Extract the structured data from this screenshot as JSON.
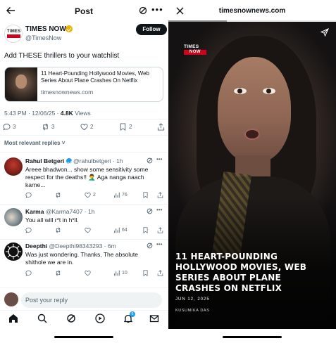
{
  "left": {
    "header": {
      "title": "Post"
    },
    "author": {
      "name": "TIMES NOW",
      "handle": "@TimesNow",
      "follow_label": "Follow",
      "logo_line1": "TIMES",
      "logo_line2": "NOW"
    },
    "post_text": "Add THESE thrillers to your watchlist",
    "card": {
      "title": "11 Heart-Pounding Hollywood Movies, Web Series About Plane Crashes On Netflix",
      "domain": "timesnownews.com"
    },
    "meta": {
      "time": "5:43 PM · 12/06/25 · ",
      "views_count": "4.8K",
      "views_label": " Views"
    },
    "actions": {
      "replies": "3",
      "reposts": "3",
      "likes": "2",
      "bookmarks": "2"
    },
    "sort_label": "Most relevant replies ˅",
    "replies": [
      {
        "name": "Rahul Betgeri",
        "meta": "@rahulbetgeri · 1h",
        "text": "Areee bhadwon... show some sensitivity some respect for the deaths!! 🤦‍♂️ Aga nanga naach karne...",
        "stats": {
          "replies": "",
          "reposts": "",
          "likes": "2",
          "views": "76"
        }
      },
      {
        "name": "Karma",
        "meta": "@Karma7407 · 1h",
        "text": "You all will r*t in h*ll.",
        "stats": {
          "replies": "",
          "reposts": "",
          "likes": "",
          "views": "64"
        }
      },
      {
        "name": "Deepthi",
        "meta": "@Deepthi98343293 · 6m",
        "text": "Was just wondering. Thanks. The absolute shithole we are in.",
        "stats": {
          "replies": "",
          "reposts": "",
          "likes": "",
          "views": "10"
        }
      }
    ],
    "compose_placeholder": "Post your reply",
    "notifications_badge": "6"
  },
  "right": {
    "url": "timesnownews.com",
    "progress": 0.35,
    "logo_line1": "TIMES",
    "logo_line2": "NOW",
    "headline": "11 HEART-POUNDING HOLLYWOOD MOVIES, WEB SERIES ABOUT PLANE CRASHES ON NETFLIX",
    "date": "JUN 12, 2025",
    "author": "KUSUMIKA DAS"
  },
  "icons": {
    "back": "arrow-left-icon",
    "grok": "grok-icon",
    "more": "more-icon",
    "reply": "reply-icon",
    "repost": "repost-icon",
    "like": "heart-icon",
    "bookmark": "bookmark-icon",
    "share": "share-icon",
    "views": "views-icon",
    "close": "close-icon",
    "send": "send-icon"
  },
  "colors": {
    "accent": "#1d9bf0",
    "brand_red": "#d0021b",
    "text": "#0f1419",
    "muted": "#536471"
  }
}
